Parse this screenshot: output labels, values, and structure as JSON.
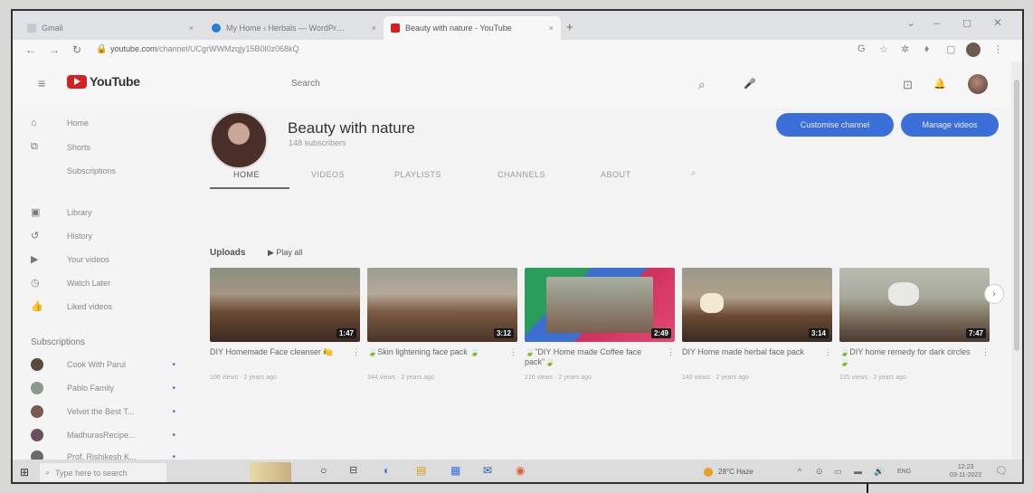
{
  "browser": {
    "tabs": [
      {
        "label": "Gmail",
        "favicon_color": "#c5c9cf"
      },
      {
        "label": "My Home ‹ Herbals — WordPr…",
        "favicon_color": "#2a7fd0"
      },
      {
        "label": "Beauty with nature - YouTube",
        "favicon_color": "#d42020"
      }
    ],
    "tab_close": "×",
    "new_tab": "+",
    "window_controls": [
      "⌄",
      "–",
      "◻",
      "✕"
    ],
    "nav": {
      "back": "←",
      "forward": "→",
      "reload": "↻"
    },
    "url_host": "youtube.com",
    "url_path": "/channel/UCgrWWMzqjy15B0l0z068kQ",
    "extension_icons": [
      "G",
      "☆",
      "✲",
      "⬧",
      "▢"
    ]
  },
  "youtube": {
    "logo_text": "YouTube",
    "search_placeholder": "Search",
    "icons": {
      "search": "⌕",
      "mic": "🎤",
      "create": "⊡",
      "bell": "🔔",
      "menu": "≡"
    }
  },
  "sidebar": {
    "items": [
      {
        "icon": "⌂",
        "label": "Home"
      },
      {
        "icon": "⧉",
        "label": "Shorts"
      },
      {
        "icon": "",
        "label": "Subscriptions"
      },
      {
        "icon": "▣",
        "label": "Library"
      },
      {
        "icon": "↺",
        "label": "History"
      },
      {
        "icon": "▶",
        "label": "Your videos"
      },
      {
        "icon": "◷",
        "label": "Watch Later"
      },
      {
        "icon": "👍",
        "label": "Liked videos"
      }
    ],
    "subscriptions_heading": "Subscriptions",
    "subscriptions": [
      {
        "label": "Cook With Parul",
        "dot": "•"
      },
      {
        "label": "Pablo Family",
        "dot": "•"
      },
      {
        "label": "Velvet the Best T...",
        "dot": "•"
      },
      {
        "label": "MadhurasRecipe...",
        "dot": "•"
      },
      {
        "label": "Prof. Rishikesh K...",
        "dot": "•"
      }
    ]
  },
  "channel": {
    "name": "Beauty with nature",
    "subscribers": "148 subscribers",
    "customise_button": "Customise channel",
    "manage_button": "Manage videos",
    "tabs": [
      "HOME",
      "VIDEOS",
      "PLAYLISTS",
      "CHANNELS",
      "ABOUT"
    ],
    "tab_search_icon": "⌕"
  },
  "uploads": {
    "heading": "Uploads",
    "play_all": "▶  Play all",
    "next_arrow": "›",
    "videos": [
      {
        "title": "DIY Homemade Face cleanser 🍋",
        "duration": "1:47",
        "meta": "106 views · 2 years ago",
        "menu": "⋮"
      },
      {
        "title": "🍃Skin lightening face pack 🍃",
        "duration": "3:12",
        "meta": "344 views · 2 years ago",
        "menu": "⋮"
      },
      {
        "title": "🍃\"DIY Home made Coffee face pack\"🍃",
        "duration": "2:49",
        "meta": "216 views · 2 years ago",
        "menu": "⋮"
      },
      {
        "title": "DIY Home made herbal face pack",
        "duration": "3:14",
        "meta": "140 views · 2 years ago",
        "menu": "⋮"
      },
      {
        "title": "🍃DIY home remedy for dark circles 🍃",
        "duration": "7:47",
        "meta": "225 views · 2 years ago",
        "menu": "⋮"
      }
    ]
  },
  "taskbar": {
    "start_icon": "⊞",
    "search_placeholder": "Type here to search",
    "search_icon": "⌕",
    "weather": "28°C  Haze",
    "tray": [
      "^",
      "⊙",
      "▭",
      "▬",
      "🔊"
    ],
    "lang": "ENG",
    "time": "12:23",
    "date": "03-11-2022",
    "notif_icon": "🗨"
  }
}
